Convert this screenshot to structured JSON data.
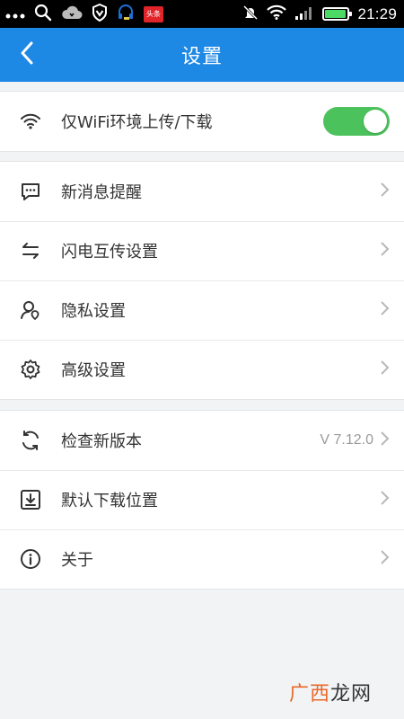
{
  "status_bar": {
    "time": "21:29",
    "news_badge": "头条",
    "battery_level": 0.95,
    "icons": [
      "more-dots-icon",
      "search-icon",
      "cloud-icon",
      "vpn-shield-icon",
      "headset-icon",
      "news-app-icon",
      "mute-icon",
      "wifi-icon",
      "signal-icon",
      "battery-icon"
    ]
  },
  "header": {
    "title": "设置",
    "back_icon": "chevron-left-icon"
  },
  "sections": [
    {
      "items": [
        {
          "label": "仅WiFi环境上传/下载",
          "icon": "wifi-icon",
          "toggle": true
        }
      ]
    },
    {
      "items": [
        {
          "label": "新消息提醒",
          "icon": "message-icon"
        },
        {
          "label": "闪电互传设置",
          "icon": "transfer-arrows-icon"
        },
        {
          "label": "隐私设置",
          "icon": "privacy-user-icon"
        },
        {
          "label": "高级设置",
          "icon": "gear-icon"
        }
      ]
    },
    {
      "items": [
        {
          "label": "检查新版本",
          "icon": "refresh-icon",
          "value": "V 7.12.0"
        },
        {
          "label": "默认下载位置",
          "icon": "download-box-icon"
        },
        {
          "label": "关于",
          "icon": "info-icon"
        }
      ]
    }
  ],
  "watermark": {
    "accent": "广西",
    "rest": "龙网"
  },
  "colors": {
    "header": "#1e88e5",
    "toggle_on": "#4cc25c",
    "background": "#f2f3f5"
  }
}
